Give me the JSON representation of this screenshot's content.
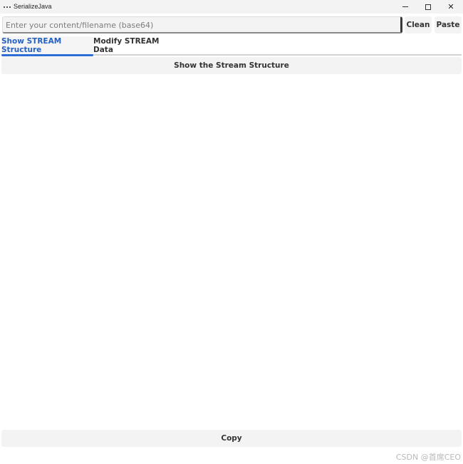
{
  "window": {
    "title": "SerializeJava",
    "icon": "app-dots-icon"
  },
  "toolbar": {
    "input_placeholder": "Enter your content/filename (base64)",
    "input_value": "",
    "clean_label": "Clean",
    "paste_label": "Paste"
  },
  "tabs": [
    {
      "label": "Show STREAM Structure",
      "active": true
    },
    {
      "label": "Modify STREAM Data",
      "active": false
    }
  ],
  "main": {
    "action_label": "Show the Stream Structure",
    "output_text": ""
  },
  "footer": {
    "copy_label": "Copy"
  },
  "watermark": "CSDN @首席CEO",
  "colors": {
    "accent": "#2b6fd6",
    "active_tab_text": "#2460c4",
    "button_bg": "#f3f3f3"
  }
}
